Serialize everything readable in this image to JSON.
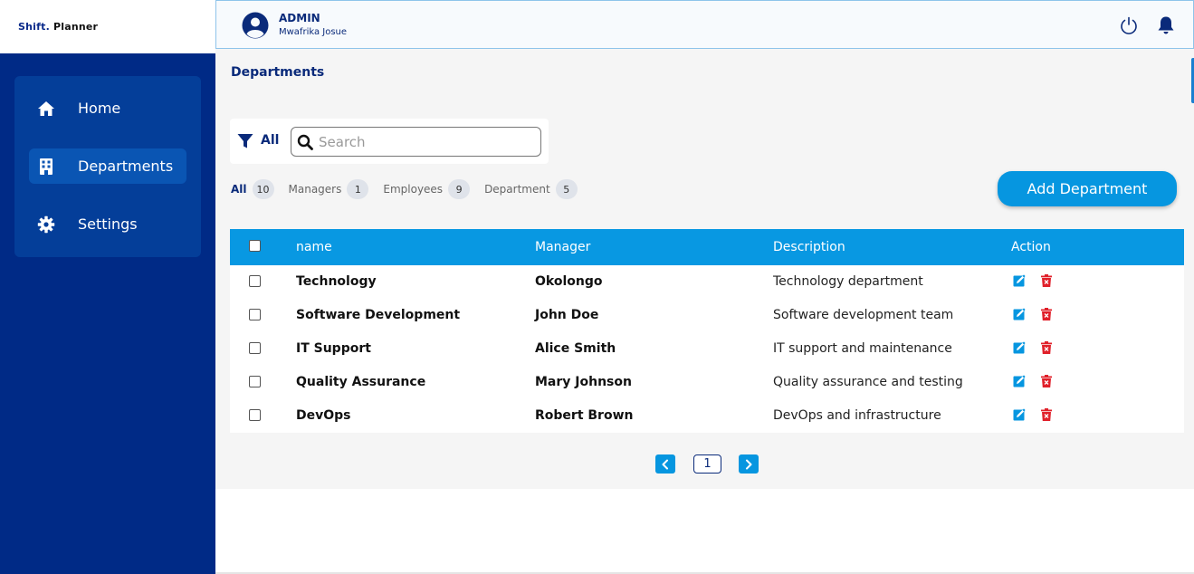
{
  "app": {
    "logo_part1": "Shift.",
    "logo_part2": " Planner"
  },
  "header": {
    "role": "ADMIN",
    "user_name": "Mwafrika Josue"
  },
  "sidebar": {
    "items": [
      {
        "label": "Home",
        "icon": "home-icon"
      },
      {
        "label": "Departments",
        "icon": "building-icon"
      },
      {
        "label": "Settings",
        "icon": "gear-icon"
      }
    ]
  },
  "main": {
    "page_title": "Departments",
    "filter_label": "All",
    "search_placeholder": "Search",
    "tabs": [
      {
        "label": "All",
        "count": "10"
      },
      {
        "label": "Managers",
        "count": "1"
      },
      {
        "label": "Employees",
        "count": "9"
      },
      {
        "label": "Department",
        "count": "5"
      }
    ],
    "add_button": "Add Department",
    "table": {
      "headers": [
        "name",
        "Manager",
        "Description",
        "Action"
      ],
      "rows": [
        {
          "name": "Technology",
          "manager": "Okolongo",
          "description": "Technology department"
        },
        {
          "name": "Software Development",
          "manager": "John Doe",
          "description": "Software development team"
        },
        {
          "name": "IT Support",
          "manager": "Alice Smith",
          "description": "IT support and maintenance"
        },
        {
          "name": "Quality Assurance",
          "manager": "Mary Johnson",
          "description": "Quality assurance and testing"
        },
        {
          "name": "DevOps",
          "manager": "Robert Brown",
          "description": "DevOps and infrastructure"
        }
      ]
    },
    "pagination": {
      "current_page": "1"
    }
  },
  "colors": {
    "sidebar_bg": "#002a86",
    "accent": "#0696e0",
    "table_header": "#0898e2",
    "delete": "#e0202a"
  }
}
